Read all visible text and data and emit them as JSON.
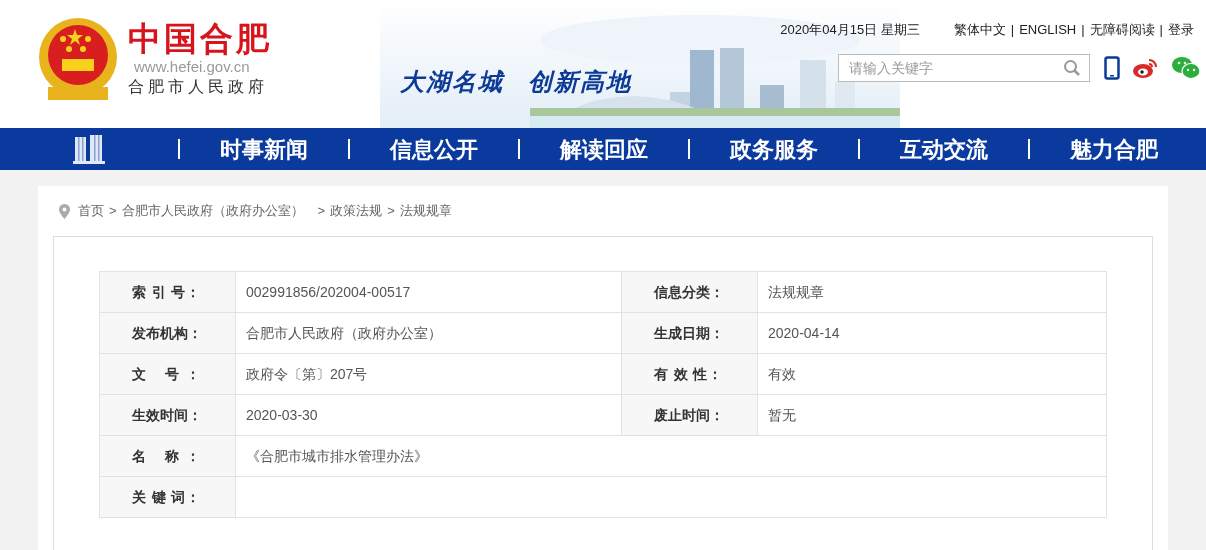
{
  "header": {
    "site_title": "中国合肥",
    "site_url": "www.hefei.gov.cn",
    "site_org": "合肥市人民政府",
    "slogan": [
      "大湖名城",
      "创新高地"
    ],
    "date": "2020年04月15日 星期三",
    "top_links": [
      {
        "kind": "link",
        "text": "繁体中文"
      },
      {
        "kind": "separator",
        "text": "|"
      },
      {
        "kind": "link",
        "text": "ENGLISH"
      },
      {
        "kind": "separator",
        "text": "|"
      },
      {
        "kind": "link",
        "text": "无障碍阅读"
      },
      {
        "kind": "separator",
        "text": "|"
      },
      {
        "kind": "link",
        "text": "登录"
      }
    ],
    "search": {
      "placeholder": "请输入关键字"
    }
  },
  "nav": [
    "时事新闻",
    "信息公开",
    "解读回应",
    "政务服务",
    "互动交流",
    "魅力合肥"
  ],
  "breadcrumb": [
    {
      "kind": "link",
      "text": "首页"
    },
    {
      "kind": "separator",
      "text": ">"
    },
    {
      "kind": "link",
      "text": "合肥市人民政府（政府办公室）"
    },
    {
      "kind": "separator",
      "text": ">"
    },
    {
      "kind": "link",
      "text": "政策法规"
    },
    {
      "kind": "separator",
      "text": ">"
    },
    {
      "kind": "link",
      "text": "法规规章"
    }
  ],
  "table": {
    "rows": [
      {
        "cells": [
          {
            "label": "索 引 号：",
            "value": "002991856/202004-00517"
          },
          {
            "label": "信息分类：",
            "value": "法规规章"
          }
        ]
      },
      {
        "cells": [
          {
            "label": "发布机构：",
            "value": "合肥市人民政府（政府办公室）"
          },
          {
            "label": "生成日期：",
            "value": "2020-04-14"
          }
        ]
      },
      {
        "cells": [
          {
            "label": "文 号：",
            "value": "政府令〔第〕207号"
          },
          {
            "label": "有 效 性：",
            "value": "有效"
          }
        ]
      },
      {
        "cells": [
          {
            "label": "生效时间：",
            "value": "2020-03-30"
          },
          {
            "label": "废止时间：",
            "value": "暂无"
          }
        ]
      },
      {
        "cells": [
          {
            "label": "名 称：",
            "value": "《合肥市城市排水管理办法》"
          }
        ]
      },
      {
        "cells": [
          {
            "label": "关 键 词："
          }
        ]
      }
    ]
  }
}
